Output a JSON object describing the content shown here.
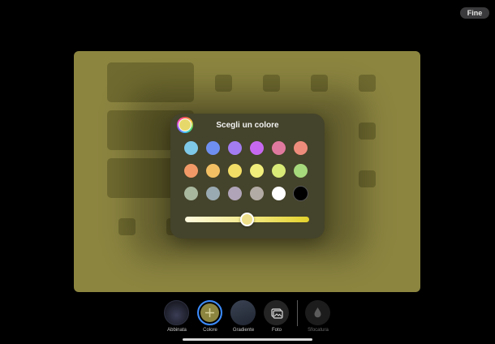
{
  "header": {
    "done_label": "Fine"
  },
  "picker": {
    "title": "Scegli un colore",
    "selected_color": "#e7d86b",
    "slider_value": 0.5,
    "swatches": [
      [
        "#7ec8e8",
        "#6f8ff0",
        "#a27cf0",
        "#c769f0",
        "#e0799e",
        "#ee8c7c"
      ],
      [
        "#f19a68",
        "#f2c063",
        "#f2dd66",
        "#f1ee7c",
        "#d9ea77",
        "#a6d97c"
      ],
      [
        "#a8b89e",
        "#9aaab2",
        "#b0a4b8",
        "#b2aaa4",
        "#ffffff",
        "#000000"
      ]
    ]
  },
  "options": [
    {
      "label": "Abbinata",
      "icon": "wallpaper-thumbnail-icon"
    },
    {
      "label": "Colore",
      "icon": "plus-icon"
    },
    {
      "label": "Gradiente",
      "icon": "gradient-icon"
    },
    {
      "label": "Foto",
      "icon": "photo-icon"
    },
    {
      "label": "Sfocatura",
      "icon": "droplet-icon"
    }
  ],
  "colors": {
    "background": "#000000",
    "preview": "#8c8540",
    "popover": "#44432b",
    "accent": "#e7d86b"
  }
}
